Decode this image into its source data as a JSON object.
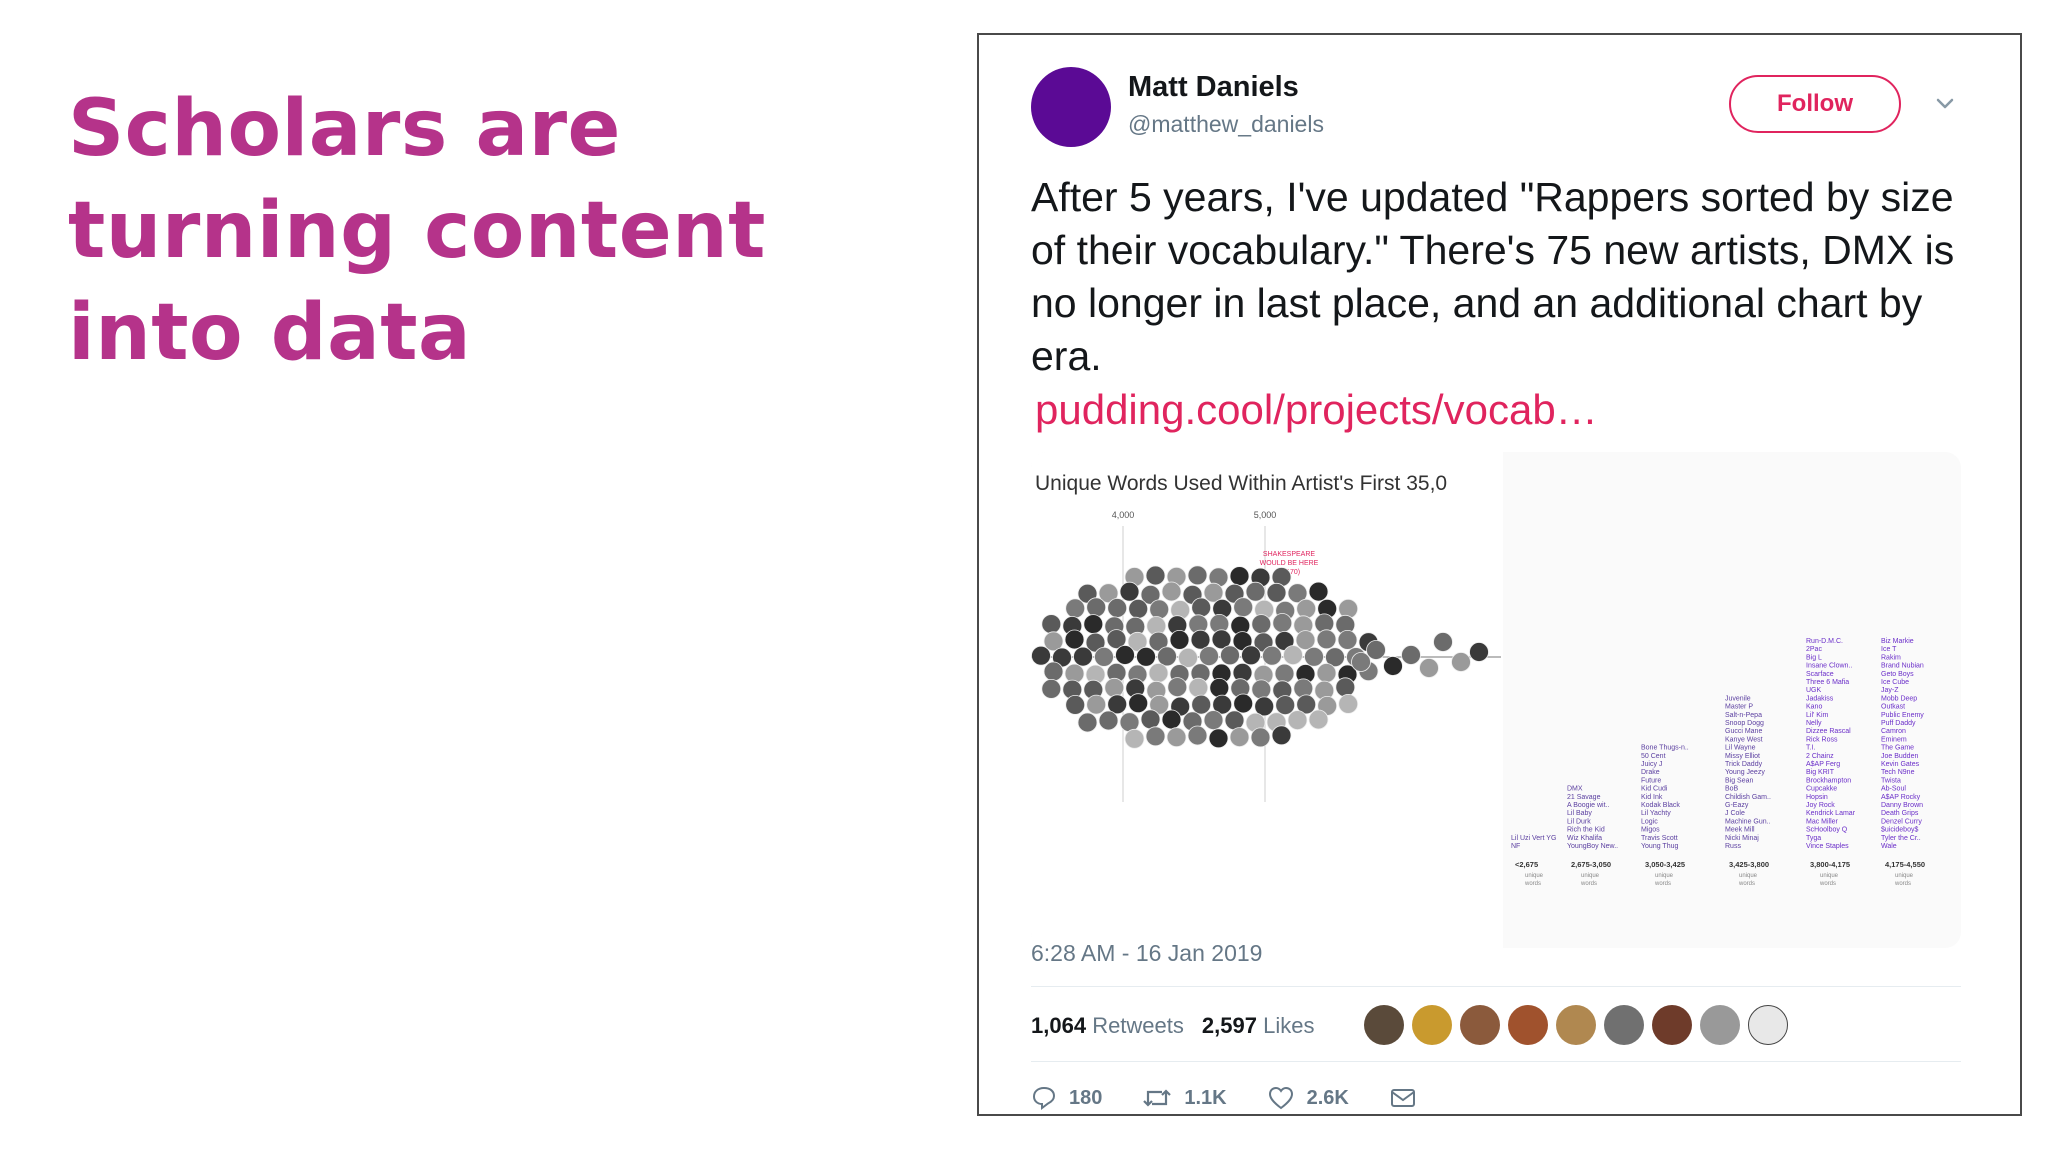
{
  "slide": {
    "title_lines": [
      "Scholars are",
      "turning content",
      "into data"
    ],
    "accent_color": "#b5338a"
  },
  "tweet": {
    "author_name": "Matt Daniels",
    "author_handle": "@matthew_daniels",
    "follow_label": "Follow",
    "text": "After 5 years, I've updated \"Rappers sorted by size of their vocabulary.\" There's 75 new artists, DMX is no longer in last place, and an additional chart by era.",
    "link_text": "pudding.cool/projects/vocab…",
    "timestamp": "6:28 AM - 16 Jan 2019",
    "retweets_count": "1,064",
    "retweets_label": "Retweets",
    "likes_count": "2,597",
    "likes_label": "Likes",
    "replies": "180",
    "retweets_short": "1.1K",
    "likes_short": "2.6K",
    "icons": [
      "reply-icon",
      "retweet-icon",
      "heart-icon",
      "mail-icon",
      "chevron-down-icon"
    ],
    "link_color": "#e0245e",
    "avatar_color": "#5b0a95"
  },
  "media": {
    "chart_title": "Unique Words Used Within Artist's First 35,0",
    "axis_ticks": [
      "4,000",
      "5,000"
    ],
    "annotation": [
      "SHAKESPEARE",
      "WOULD BE HERE",
      "(5,170)"
    ],
    "columns": [
      {
        "names": [
          "Lil Uzi Vert YG",
          "NF"
        ],
        "range": "<2,675",
        "unit": [
          "unique",
          "words"
        ]
      },
      {
        "names": [
          "DMX",
          "21 Savage",
          "A Boogie wit..",
          "Lil Baby",
          "Lil Durk",
          "Rich the Kid",
          "Wiz Khalifa",
          "YoungBoy New.."
        ],
        "range": "2,675-3,050",
        "unit": [
          "unique",
          "words"
        ]
      },
      {
        "names": [
          "Bone Thugs-n..",
          "50 Cent",
          "Juicy J",
          "Drake",
          "Future",
          "Kid Cudi",
          "Kid Ink",
          "Kodak Black",
          "Lil Yachty",
          "Logic",
          "Migos",
          "Travis Scott",
          "Young Thug"
        ],
        "range": "3,050-3,425",
        "unit": [
          "unique",
          "words"
        ]
      },
      {
        "names": [
          "Juvenile",
          "Master P",
          "Salt-n-Pepa",
          "Snoop Dogg",
          "Gucci Mane",
          "Kanye West",
          "Lil Wayne",
          "Missy Elliot",
          "Trick Daddy",
          "Young Jeezy",
          "Big Sean",
          "BoB",
          "Childish Gam..",
          "G-Eazy",
          "J Cole",
          "Machine Gun..",
          "Meek Mill",
          "Nicki Minaj",
          "Russ"
        ],
        "range": "3,425-3,800",
        "unit": [
          "unique",
          "words"
        ]
      },
      {
        "names": [
          "Run-D.M.C.",
          "2Pac",
          "Big L",
          "Insane Clown..",
          "Scarface",
          "Three 6 Mafia",
          "UGK",
          "Jadakiss",
          "Kano",
          "Lil' Kim",
          "Nelly",
          "Dizzee Rascal",
          "Rick Ross",
          "T.I.",
          "2 Chainz",
          "A$AP Ferg",
          "Big KRIT",
          "Brockhampton",
          "Cupcakke",
          "Hopsin",
          "Joy Rock",
          "Kendrick Lamar",
          "Mac Miller",
          "ScHoolboy Q",
          "Tyga",
          "Vince Staples"
        ],
        "range": "3,800-4,175",
        "unit": [
          "unique",
          "words"
        ]
      },
      {
        "names": [
          "Biz Markie",
          "Ice T",
          "Rakim",
          "Brand Nubian",
          "Geto Boys",
          "Ice Cube",
          "Jay-Z",
          "Mobb Deep",
          "Outkast",
          "Public Enemy",
          "Puff Daddy",
          "Camron",
          "Eminem",
          "The Game",
          "Joe Budden",
          "Kevin Gates",
          "Tech N9ne",
          "Twista",
          "Ab-Soul",
          "A$AP Rocky",
          "Danny Brown",
          "Death Grips",
          "Denzel Curry",
          "$uicideboy$",
          "Tyler the Cr..",
          "Wale"
        ],
        "range": "4,175-4,550",
        "unit": [
          "unique",
          "words"
        ]
      }
    ]
  }
}
